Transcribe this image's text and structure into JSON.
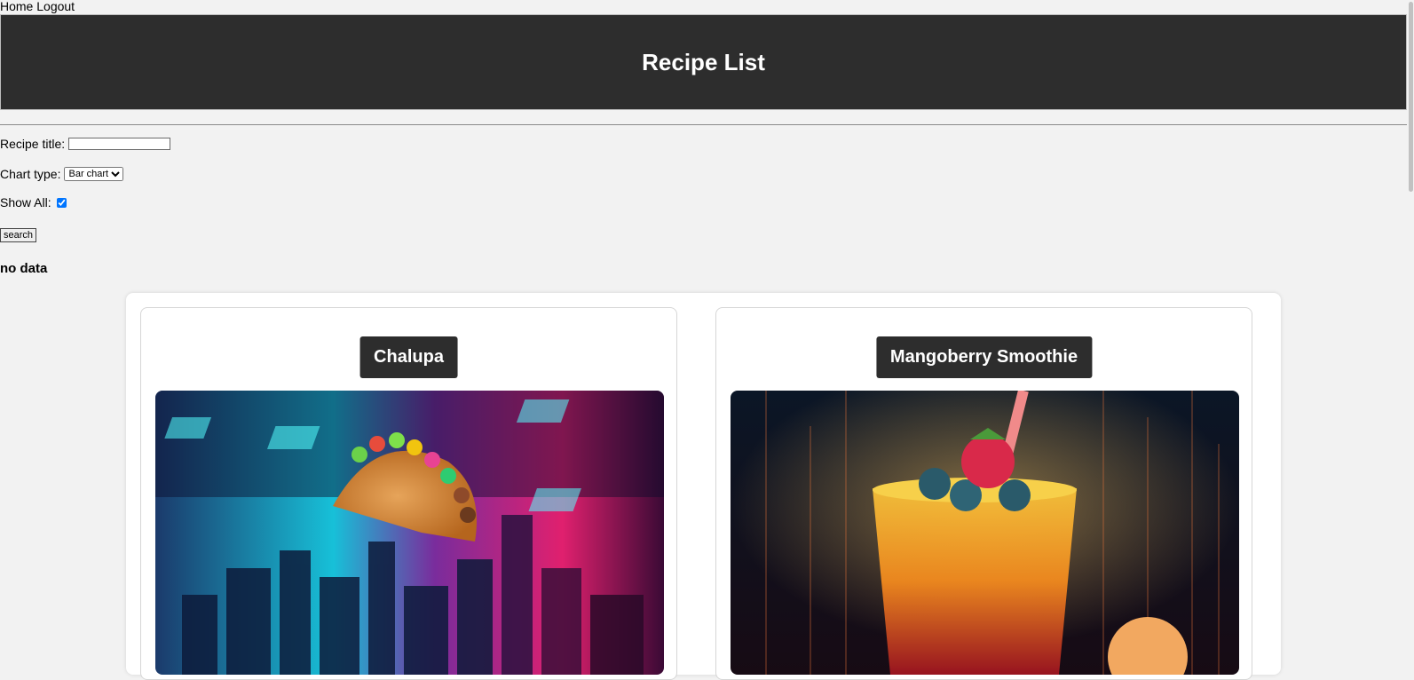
{
  "nav": {
    "home": "Home",
    "logout": "Logout"
  },
  "header": {
    "title": "Recipe List"
  },
  "form": {
    "title_label": "Recipe title:",
    "title_value": "",
    "chart_type_label": "Chart type:",
    "chart_type_selected": "Bar chart",
    "show_all_label": "Show All:",
    "show_all_checked": true,
    "search_label": "search"
  },
  "status": {
    "message": "no data"
  },
  "recipes": [
    {
      "title": "Chalupa",
      "image_icon": "taco-cyberpunk-city-image"
    },
    {
      "title": "Mangoberry Smoothie",
      "image_icon": "smoothie-neon-image"
    }
  ],
  "colors": {
    "header_bg": "#2d2d2d",
    "page_bg": "#f2f2f2"
  }
}
